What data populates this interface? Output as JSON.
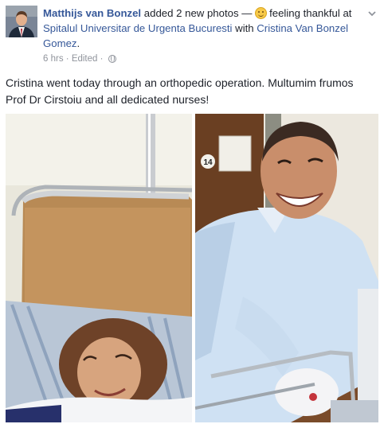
{
  "post": {
    "author": "Matthijs van Bonzel",
    "action_text": " added 2 new photos — ",
    "feeling_text": "feeling thankful at ",
    "place": "Spitalul Universitar de Urgenta Bucuresti",
    "with_text": " with ",
    "tagged": "Cristina Van Bonzel Gomez",
    "period": ".",
    "time": "6 hrs",
    "separator": " · ",
    "edited": "Edited",
    "separator2": " · ",
    "message": "Cristina went today through an orthopedic operation. Multumim frumos Prof Dr Cirstoiu and all dedicated nurses!",
    "feeling_icon": "smile-emoji-icon",
    "privacy_icon": "globe-icon",
    "menu_icon": "chevron-down-icon",
    "photo_room_number": "14"
  },
  "colors": {
    "link": "#365899",
    "text": "#1d2129",
    "muted": "#90949c"
  }
}
